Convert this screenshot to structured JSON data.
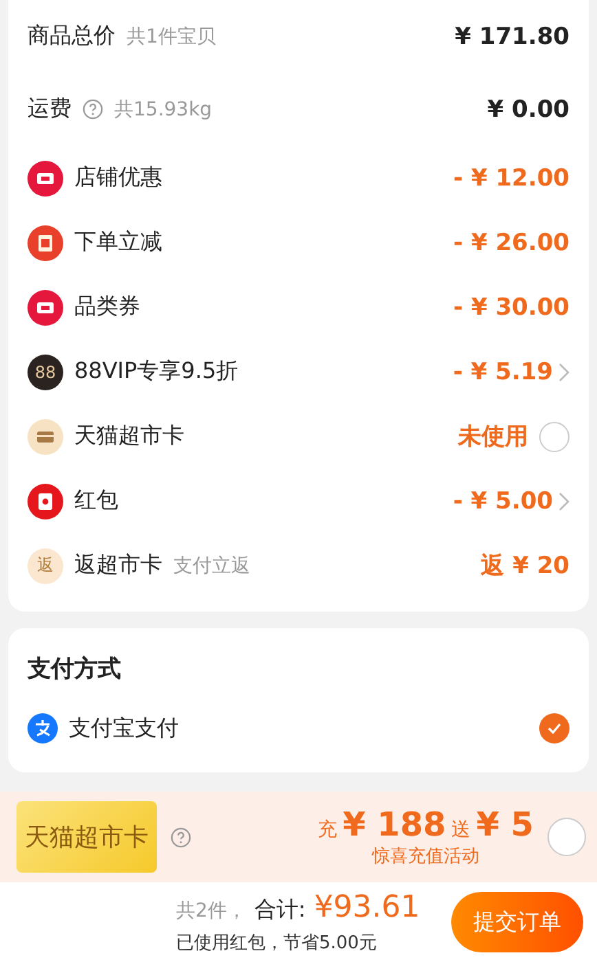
{
  "summary": {
    "rows": [
      {
        "kind": "total",
        "label": "商品总价",
        "note": "共1件宝贝",
        "value": "¥ 171.80"
      },
      {
        "kind": "shipping",
        "label": "运费",
        "note": "共15.93kg",
        "value": "¥ 0.00"
      },
      {
        "kind": "coupon",
        "label": "店铺优惠",
        "value": "- ¥ 12.00"
      },
      {
        "kind": "instant",
        "label": "下单立减",
        "value": "- ¥ 26.00"
      },
      {
        "kind": "coupon",
        "label": "品类券",
        "value": "- ¥ 30.00"
      },
      {
        "kind": "vip",
        "badge": "88",
        "label": "88VIP专享9.5折",
        "value": "- ¥ 5.19",
        "chevron": true
      },
      {
        "kind": "card",
        "label": "天猫超市卡",
        "value": "未使用",
        "checked": false
      },
      {
        "kind": "redpacket",
        "label": "红包",
        "value": "- ¥ 5.00",
        "chevron": true
      },
      {
        "kind": "rebate",
        "badge": "返",
        "label": "返超市卡",
        "note": "支付立返",
        "value": "返 ¥ 20"
      }
    ]
  },
  "payment": {
    "title": "支付方式",
    "methods": [
      {
        "label": "支付宝支付",
        "selected": true
      }
    ]
  },
  "promo": {
    "card_label": "天猫超市卡",
    "charge_prefix": "充",
    "charge_amount": "¥ 188",
    "gift_prefix": "送",
    "gift_amount": "¥ 5",
    "subtitle": "惊喜充值活动",
    "checked": false
  },
  "footer": {
    "count": "共2件，",
    "total_label": "合计:",
    "total": "¥93.61",
    "saving": "已使用红包，节省5.00元",
    "submit": "提交订单"
  }
}
